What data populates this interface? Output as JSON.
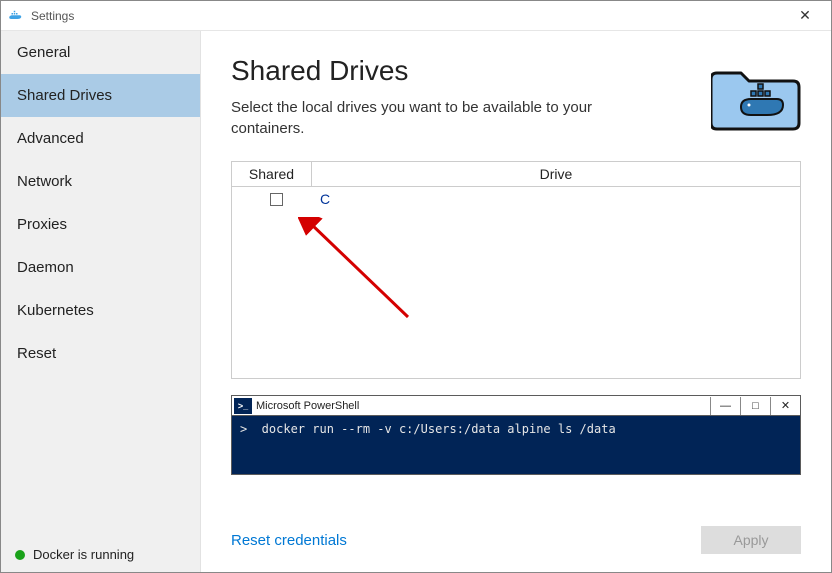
{
  "titlebar": {
    "title": "Settings"
  },
  "sidebar": {
    "items": [
      {
        "label": "General"
      },
      {
        "label": "Shared Drives"
      },
      {
        "label": "Advanced"
      },
      {
        "label": "Network"
      },
      {
        "label": "Proxies"
      },
      {
        "label": "Daemon"
      },
      {
        "label": "Kubernetes"
      },
      {
        "label": "Reset"
      }
    ],
    "active_index": 1,
    "status_text": "Docker is running"
  },
  "main": {
    "heading": "Shared Drives",
    "subtitle": "Select the local drives you want to be available to your containers.",
    "table": {
      "col_shared": "Shared",
      "col_drive": "Drive",
      "rows": [
        {
          "shared": false,
          "drive": "C"
        }
      ]
    },
    "powershell": {
      "title": "Microsoft PowerShell",
      "command": ">  docker run --rm -v c:/Users:/data alpine ls /data"
    },
    "reset_link": "Reset credentials",
    "apply_label": "Apply"
  }
}
